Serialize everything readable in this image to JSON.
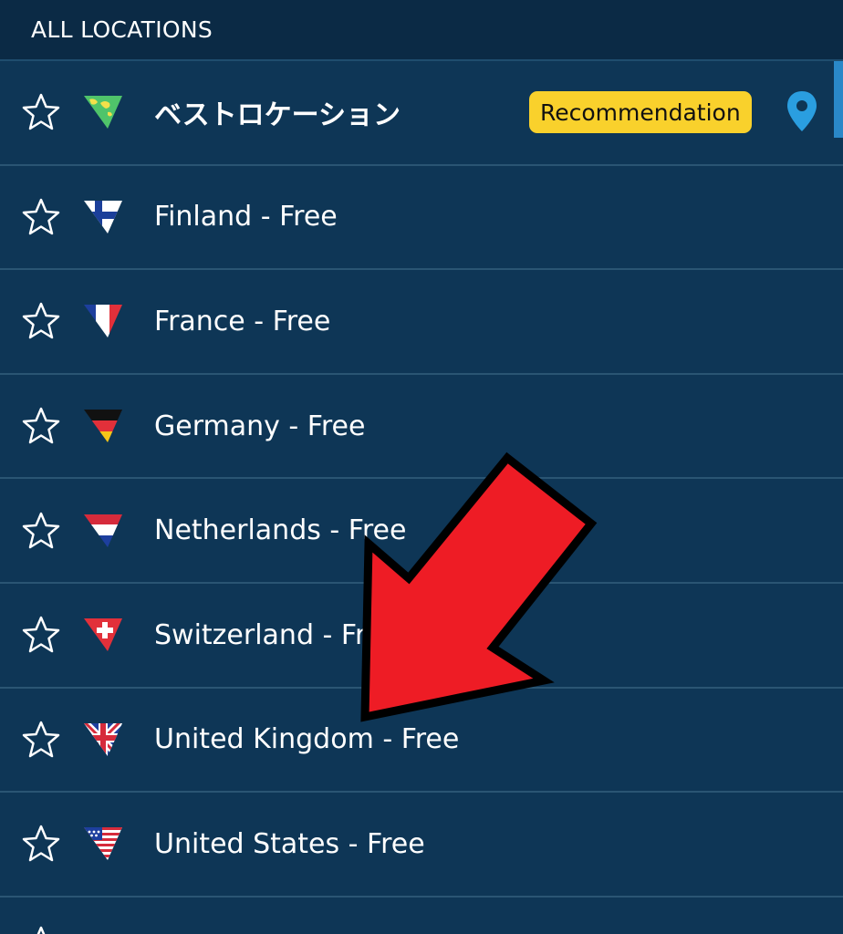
{
  "header": {
    "title": "ALL LOCATIONS"
  },
  "locations": [
    {
      "label": "ベストロケーション",
      "flag": "world-map-flag-icon",
      "badge": "Recommendation",
      "pin": "location-pin-icon"
    },
    {
      "label": "Finland - Free",
      "flag": "finland-flag-icon"
    },
    {
      "label": "France - Free",
      "flag": "france-flag-icon"
    },
    {
      "label": "Germany - Free",
      "flag": "germany-flag-icon"
    },
    {
      "label": "Netherlands - Free",
      "flag": "netherlands-flag-icon"
    },
    {
      "label": "Switzerland - Free",
      "flag": "switzerland-flag-icon"
    },
    {
      "label": "United Kingdom - Free",
      "flag": "united-kingdom-flag-icon"
    },
    {
      "label": "United States - Free",
      "flag": "united-states-flag-icon"
    }
  ],
  "colors": {
    "background": "#0e3656",
    "header_background": "#0b2a45",
    "badge": "#f9d12c",
    "pin": "#2a9ee0",
    "annotation_arrow": "#ee1c25"
  }
}
